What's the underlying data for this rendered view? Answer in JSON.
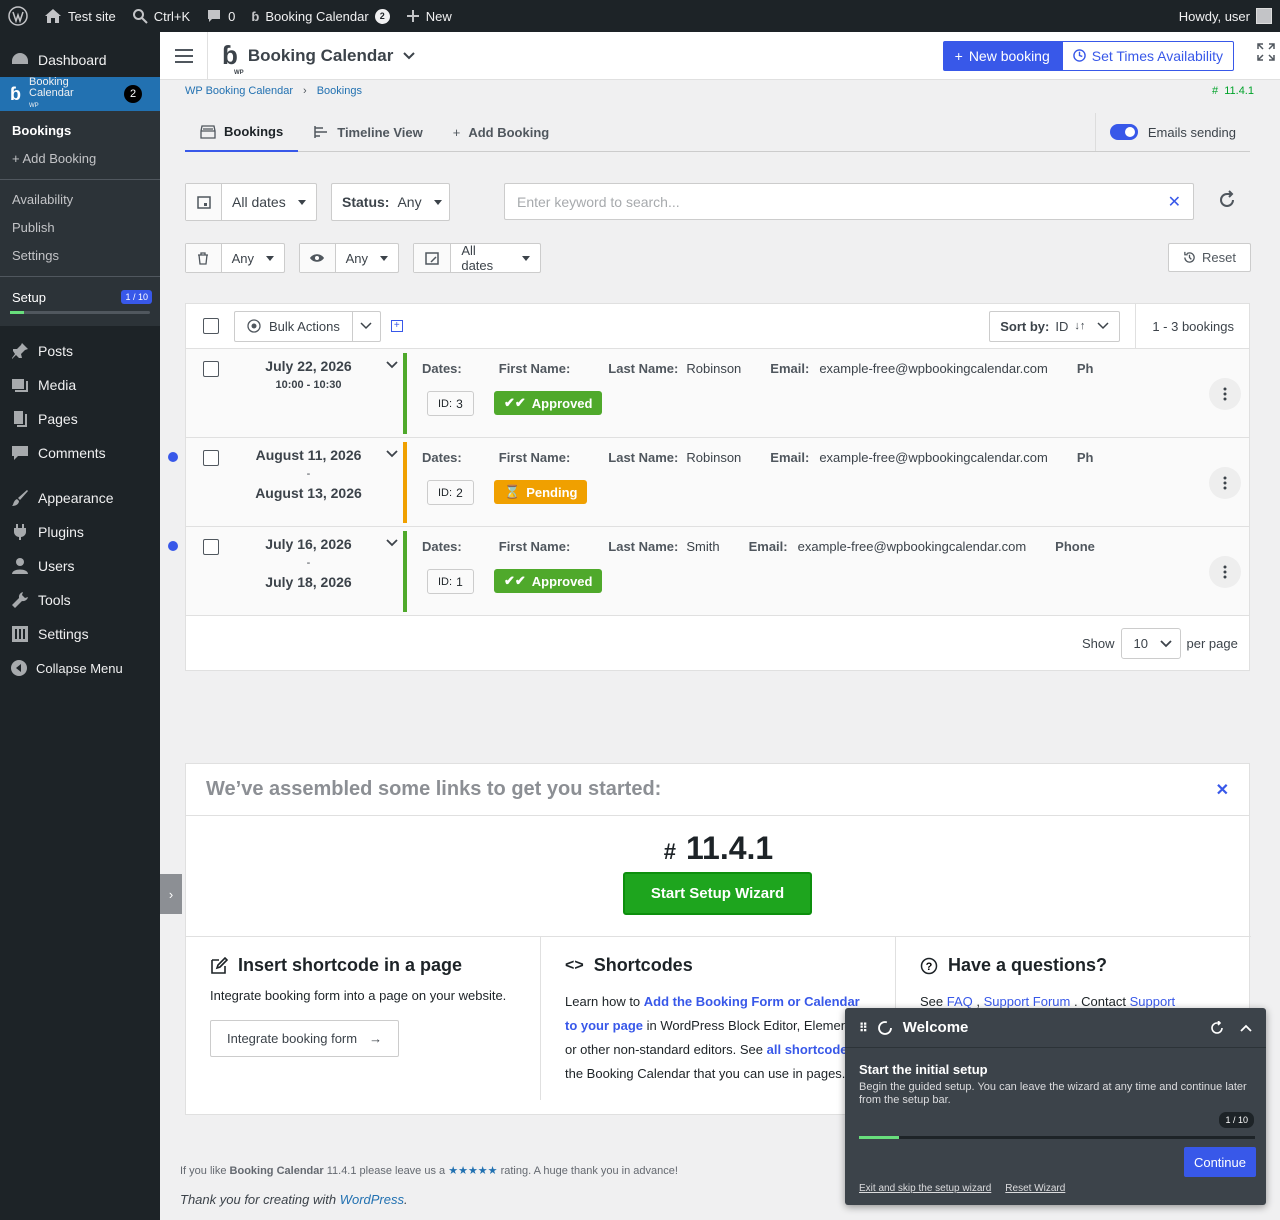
{
  "adminbar": {
    "site": "Test site",
    "search": "Ctrl+K",
    "comments": "0",
    "booking_calendar": "Booking Calendar",
    "booking_count": "2",
    "new": "New",
    "howdy": "Howdy, user"
  },
  "sidebar": {
    "dashboard": "Dashboard",
    "booking_calendar": "Booking Calendar",
    "booking_sub": "WP",
    "booking_count": "2",
    "sub": {
      "bookings": "Bookings",
      "add_booking": "+ Add Booking",
      "availability": "Availability",
      "publish": "Publish",
      "settings": "Settings",
      "setup": "Setup",
      "setup_progress": "1 / 10"
    },
    "items": [
      "Posts",
      "Media",
      "Pages",
      "Comments",
      "Appearance",
      "Plugins",
      "Users",
      "Tools",
      "Settings",
      "Collapse Menu"
    ]
  },
  "topbar": {
    "title": "Booking Calendar",
    "logo_sub": "WP",
    "new_booking": "New booking",
    "set_times": "Set Times Availability"
  },
  "breadcrumb": {
    "root": "WP Booking Calendar",
    "current": "Bookings"
  },
  "version_top": "11.4.1",
  "tabs": {
    "bookings": "Bookings",
    "timeline": "Timeline View",
    "add": "Add Booking",
    "emails": "Emails sending"
  },
  "filters": {
    "dates": "All dates",
    "status_label": "Status:",
    "status_value": "Any",
    "search_placeholder": "Enter keyword to search...",
    "trash_value": "Any",
    "read_value": "Any",
    "created_dates": "All dates",
    "reset": "Reset"
  },
  "list": {
    "bulk": "Bulk Actions",
    "sort_label": "Sort by:",
    "sort_value": "ID",
    "count": "1 - 3 bookings",
    "labels": {
      "dates": "Dates:",
      "first": "First Name:",
      "last": "Last Name:",
      "email": "Email:"
    },
    "rows": [
      {
        "date1": "July 22, 2026",
        "date2": "",
        "time": "10:00 -  10:30",
        "last": "Robinson",
        "email": "example-free@wpbookingcalendar.com",
        "phone": "Ph",
        "id_label": "ID:",
        "id": "3",
        "status": "Approved",
        "bar_color": "#4fa92b"
      },
      {
        "date1": "August 11, 2026",
        "date2": "August 13, 2026",
        "time": "",
        "last": "Robinson",
        "email": "example-free@wpbookingcalendar.com",
        "phone": "Ph",
        "id_label": "ID:",
        "id": "2",
        "status": "Pending",
        "bar_color": "#f0a000"
      },
      {
        "date1": "July 16, 2026",
        "date2": "July 18, 2026",
        "time": "",
        "last": "Smith",
        "email": "example-free@wpbookingcalendar.com",
        "phone": "Phone",
        "id_label": "ID:",
        "id": "1",
        "status": "Approved",
        "bar_color": "#4fa92b"
      }
    ],
    "show": "Show",
    "per_page_value": "10",
    "per_page": "per page"
  },
  "welcome": {
    "heading": "We’ve assembled some links to get you started:",
    "hash": "#",
    "version": "11.4.1",
    "wizard": "Start Setup Wizard",
    "col1_title": "Insert shortcode in a page",
    "col1_text": "Integrate booking form into a page on your website.",
    "col1_btn": "Integrate booking form",
    "col2_title": "Shortcodes",
    "col2_pre": "Learn how to ",
    "col2_link": "Add the Booking Form or Calendar to your page",
    "col2_mid": " in WordPress Block Editor, Elementor, or other non-standard editors. See ",
    "col2_link2": "all shortcodes",
    "col2_post": " of the Booking Calendar that you can use in pages.",
    "col3_title": "Have a questions?",
    "col3_see": "See",
    "col3_faq": "FAQ",
    "col3_forum": "Support Forum",
    "col3_contact": "Contact",
    "col3_support": "Support"
  },
  "footer": {
    "pre": "If you like ",
    "name": "Booking Calendar",
    "mid": " 11.4.1 please leave us a ",
    "stars": "★★★★★",
    "post": " rating. A huge thank you in advance!",
    "thanks_pre": "Thank you for creating with ",
    "wp": "WordPress",
    "thanks_post": "."
  },
  "popup": {
    "title": "Welcome",
    "heading": "Start the initial setup",
    "text": "Begin the guided setup. You can leave the wizard at any time and continue later from the setup bar.",
    "badge": "1 / 10",
    "progress": 0.1,
    "continue": "Continue",
    "exit": "Exit and skip the setup wizard",
    "reset": "Reset Wizard"
  }
}
